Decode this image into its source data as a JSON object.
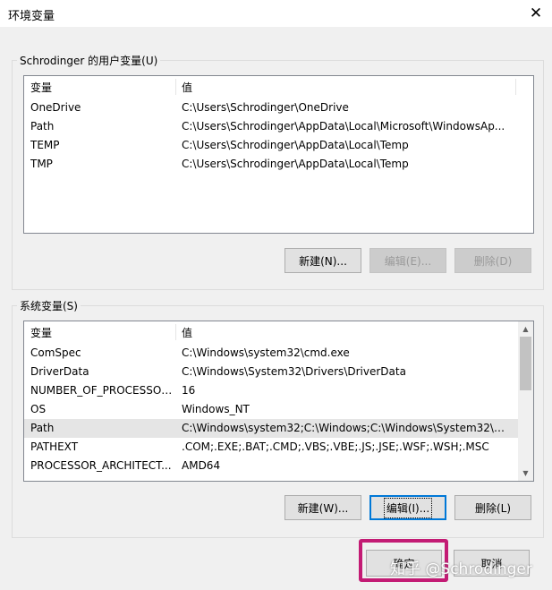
{
  "window": {
    "title": "环境变量",
    "close_glyph": "✕"
  },
  "user_vars": {
    "group_label": "Schrodinger 的用户变量(U)",
    "columns": [
      "变量",
      "值"
    ],
    "rows": [
      {
        "name": "OneDrive",
        "value": "C:\\Users\\Schrodinger\\OneDrive"
      },
      {
        "name": "Path",
        "value": "C:\\Users\\Schrodinger\\AppData\\Local\\Microsoft\\WindowsAp..."
      },
      {
        "name": "TEMP",
        "value": "C:\\Users\\Schrodinger\\AppData\\Local\\Temp"
      },
      {
        "name": "TMP",
        "value": "C:\\Users\\Schrodinger\\AppData\\Local\\Temp"
      }
    ],
    "buttons": {
      "new": "新建(N)...",
      "edit": "编辑(E)...",
      "delete": "删除(D)"
    }
  },
  "system_vars": {
    "group_label": "系统变量(S)",
    "columns": [
      "变量",
      "值"
    ],
    "rows": [
      {
        "name": "ComSpec",
        "value": "C:\\Windows\\system32\\cmd.exe"
      },
      {
        "name": "DriverData",
        "value": "C:\\Windows\\System32\\Drivers\\DriverData"
      },
      {
        "name": "NUMBER_OF_PROCESSORS",
        "value": "16"
      },
      {
        "name": "OS",
        "value": "Windows_NT"
      },
      {
        "name": "Path",
        "value": "C:\\Windows\\system32;C:\\Windows;C:\\Windows\\System32\\Wb..."
      },
      {
        "name": "PATHEXT",
        "value": ".COM;.EXE;.BAT;.CMD;.VBS;.VBE;.JS;.JSE;.WSF;.WSH;.MSC"
      },
      {
        "name": "PROCESSOR_ARCHITECT...",
        "value": "AMD64"
      }
    ],
    "selected_row": "Path",
    "scroll_fraction": 0.0,
    "buttons": {
      "new": "新建(W)...",
      "edit": "编辑(I)...",
      "delete": "删除(L)"
    }
  },
  "footer": {
    "ok": "确定",
    "cancel": "取消"
  },
  "watermark": "知乎 @Schrodinger",
  "colors": {
    "highlight": "#c31b74",
    "focus": "#0078d7",
    "selection": "#e5e5e5"
  }
}
